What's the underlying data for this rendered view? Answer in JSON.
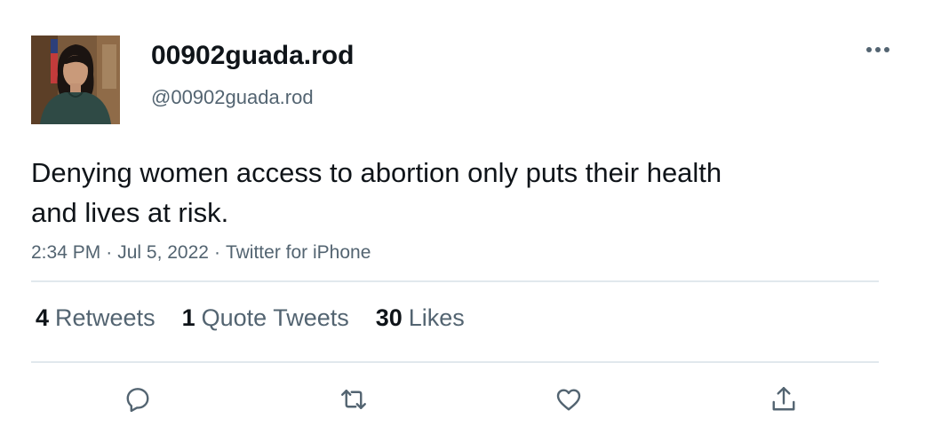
{
  "user": {
    "display_name": "00902guada.rod",
    "handle": "@00902guada.rod",
    "avatar_icon": "profile-photo"
  },
  "tweet": {
    "text": "Denying women access to abortion only puts their health and lives at risk.",
    "time": "2:34 PM",
    "date": "Jul 5, 2022",
    "source": "Twitter for iPhone",
    "separator": "·"
  },
  "stats": {
    "retweets": {
      "count": "4",
      "label": "Retweets"
    },
    "quotes": {
      "count": "1",
      "label": "Quote Tweets"
    },
    "likes": {
      "count": "30",
      "label": "Likes"
    }
  },
  "actions": {
    "reply_icon": "reply-icon",
    "retweet_icon": "retweet-icon",
    "like_icon": "heart-icon",
    "share_icon": "share-icon"
  },
  "colors": {
    "text": "#0f1419",
    "secondary": "#536471",
    "divider": "#e1e8ed"
  }
}
